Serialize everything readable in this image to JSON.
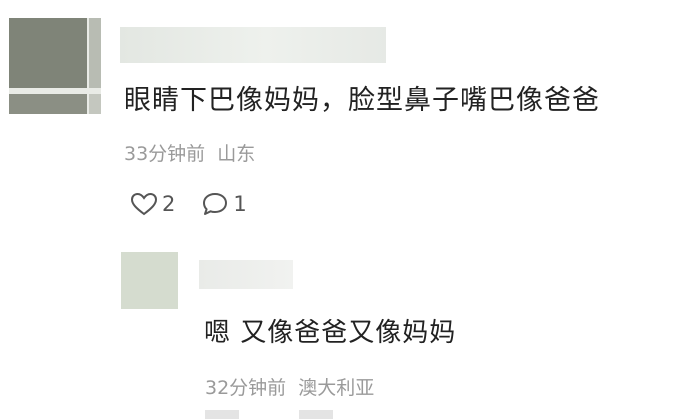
{
  "comment": {
    "text": "眼睛下巴像妈妈，脸型鼻子嘴巴像爸爸",
    "time": "33分钟前",
    "location": "山东",
    "likes": "2",
    "replies": "1",
    "icons": [
      "heart-icon",
      "comment-icon"
    ]
  },
  "reply": {
    "text": "嗯 又像爸爸又像妈妈",
    "time": "32分钟前",
    "location": "澳大利亚"
  }
}
